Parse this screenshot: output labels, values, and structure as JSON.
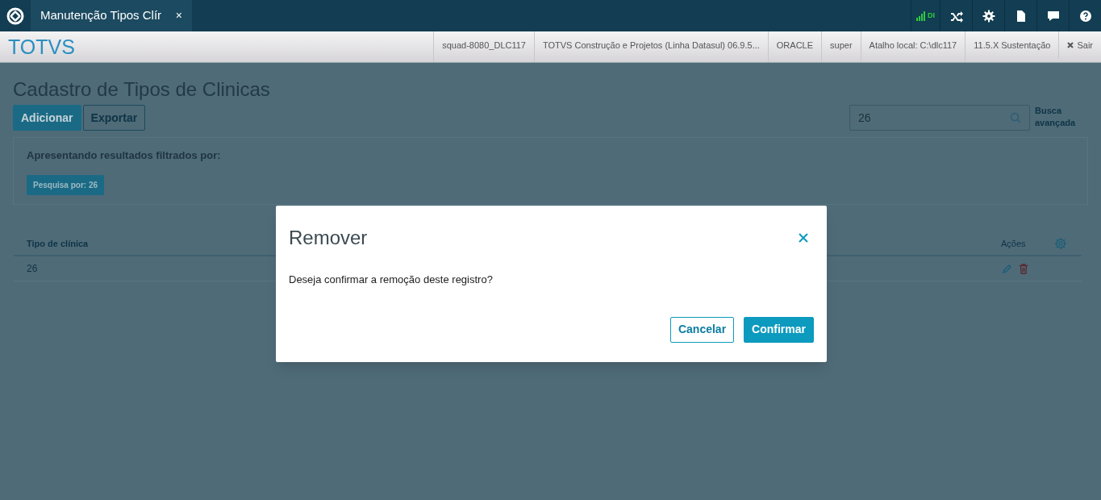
{
  "top_bar": {
    "tab": {
      "title": "Manutenção Tipos Clír",
      "close": "×"
    },
    "signal_label": "DI"
  },
  "header": {
    "brand": "TOTVS",
    "info": [
      "squad-8080_DLC117",
      "TOTVS Construção e Projetos (Linha Datasul) 06.9.5...",
      "ORACLE",
      "super",
      "Atalho local: C:\\dlc117",
      "11.5.X Sustentação"
    ],
    "logout": "Sair"
  },
  "page": {
    "title": "Cadastro de Tipos de Clinicas",
    "buttons": [
      {
        "label": "Adicionar",
        "kind": "primary"
      },
      {
        "label": "Exportar",
        "kind": "secondary"
      }
    ],
    "search": {
      "value": "26",
      "advanced": "Busca avançada"
    },
    "filter": {
      "heading": "Apresentando resultados filtrados por:",
      "tag": "Pesquisa por: 26"
    },
    "table": {
      "columns": [
        "Tipo de clínica",
        "Ações"
      ],
      "rows": [
        {
          "cells": [
            "26"
          ]
        }
      ]
    }
  },
  "dialog": {
    "title": "Remover",
    "message": "Deseja confirmar a remoção deste registro?",
    "buttons": [
      {
        "label": "Cancelar",
        "kind": "secondary"
      },
      {
        "label": "Confirmar",
        "kind": "primary"
      }
    ]
  }
}
